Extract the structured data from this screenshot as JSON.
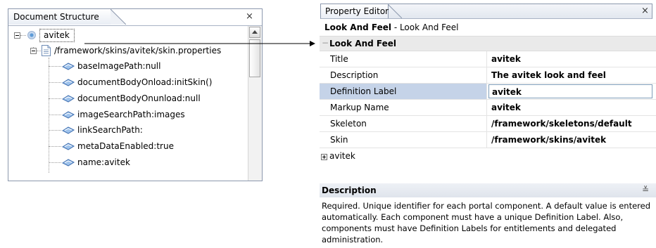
{
  "document_structure": {
    "title": "Document Structure",
    "close_glyph": "×",
    "root": {
      "label": "avitek"
    },
    "file_node": {
      "label": "/framework/skins/avitek/skin.properties"
    },
    "properties": [
      "baseImagePath:null",
      "documentBodyOnload:initSkin()",
      "documentBodyOnunload:null",
      "imageSearchPath:images",
      "linkSearchPath:",
      "metaDataEnabled:true",
      "name:avitek"
    ]
  },
  "property_editor": {
    "title": "Property Editor",
    "close_glyph": "×",
    "header_bold": "Look And Feel",
    "header_rest": " - Look And Feel",
    "category": "Look And Feel",
    "category_collapse_glyph": "−",
    "rows": [
      {
        "label": "Title",
        "value": "avitek"
      },
      {
        "label": "Description",
        "value": "The avitek look and feel"
      },
      {
        "label": "Definition Label",
        "value": "avitek"
      },
      {
        "label": "Markup Name",
        "value": "avitek"
      },
      {
        "label": "Skeleton",
        "value": "/framework/skeletons/default"
      },
      {
        "label": "Skin",
        "value": "/framework/skins/avitek"
      }
    ],
    "subgroup": "avitek",
    "description_title": "Description",
    "description_collapse_glyph": "≚",
    "description_text": "Required. Unique identifier for each portal component. A default value is entered automatically. Each component must have a unique Definition Label. Also, components must have Definition Labels for entitlements and delegated administration."
  }
}
